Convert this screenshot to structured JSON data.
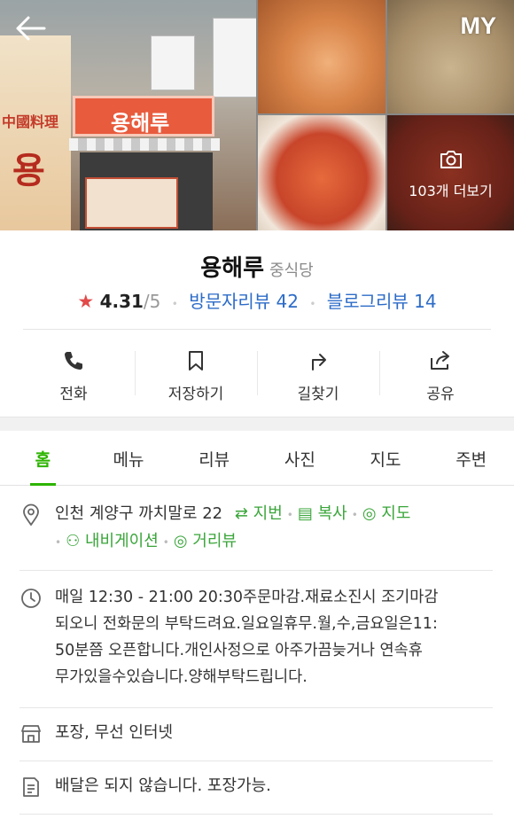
{
  "header": {
    "back_label": "<",
    "my_label": "MY",
    "more_photos_label": "103개 더보기",
    "shop_sign_text": "용해루"
  },
  "place": {
    "name": "용해루",
    "category": "중식당",
    "rating": "4.31",
    "rating_max": "/5",
    "visitor_reviews": "방문자리뷰 42",
    "blog_reviews": "블로그리뷰 14"
  },
  "actions": [
    {
      "label": "전화",
      "icon": "phone-icon"
    },
    {
      "label": "저장하기",
      "icon": "bookmark-icon"
    },
    {
      "label": "길찾기",
      "icon": "directions-icon"
    },
    {
      "label": "공유",
      "icon": "share-icon"
    }
  ],
  "tabs": [
    "홈",
    "메뉴",
    "리뷰",
    "사진",
    "지도",
    "주변"
  ],
  "info": {
    "address": "인천 계양구 까치말로 22",
    "address_links": [
      "지번",
      "복사",
      "지도"
    ],
    "nav_links": [
      "내비게이션",
      "거리뷰"
    ],
    "hours": "매일 12:30 - 21:00 20:30주문마감.재료소진시 조기마감되오니 전화문의 부탁드려요.일요일휴무.월,수,금요일은11:50분쯤 오픈합니다.개인사정으로 아주가끔늦거나 연속휴무가있을수있습니다.양해부탁드립니다.",
    "hours_lines": [
      "매일 12:30 - 21:00 20:30주문마감.재료소진시 조기마감",
      "되오니 전화문의 부탁드려요.일요일휴무.월,수,금요일은11:",
      "50분쯤 오픈합니다.개인사정으로 아주가끔늦거나 연속휴",
      "무가있을수있습니다.양해부탁드립니다."
    ],
    "facilities": "포장, 무선 인터넷",
    "delivery": "배달은 되지 않습니다. 포장가능."
  },
  "colors": {
    "accent_green": "#2db400",
    "link_blue": "#2d6cc8",
    "star_red": "#e24a4a"
  }
}
